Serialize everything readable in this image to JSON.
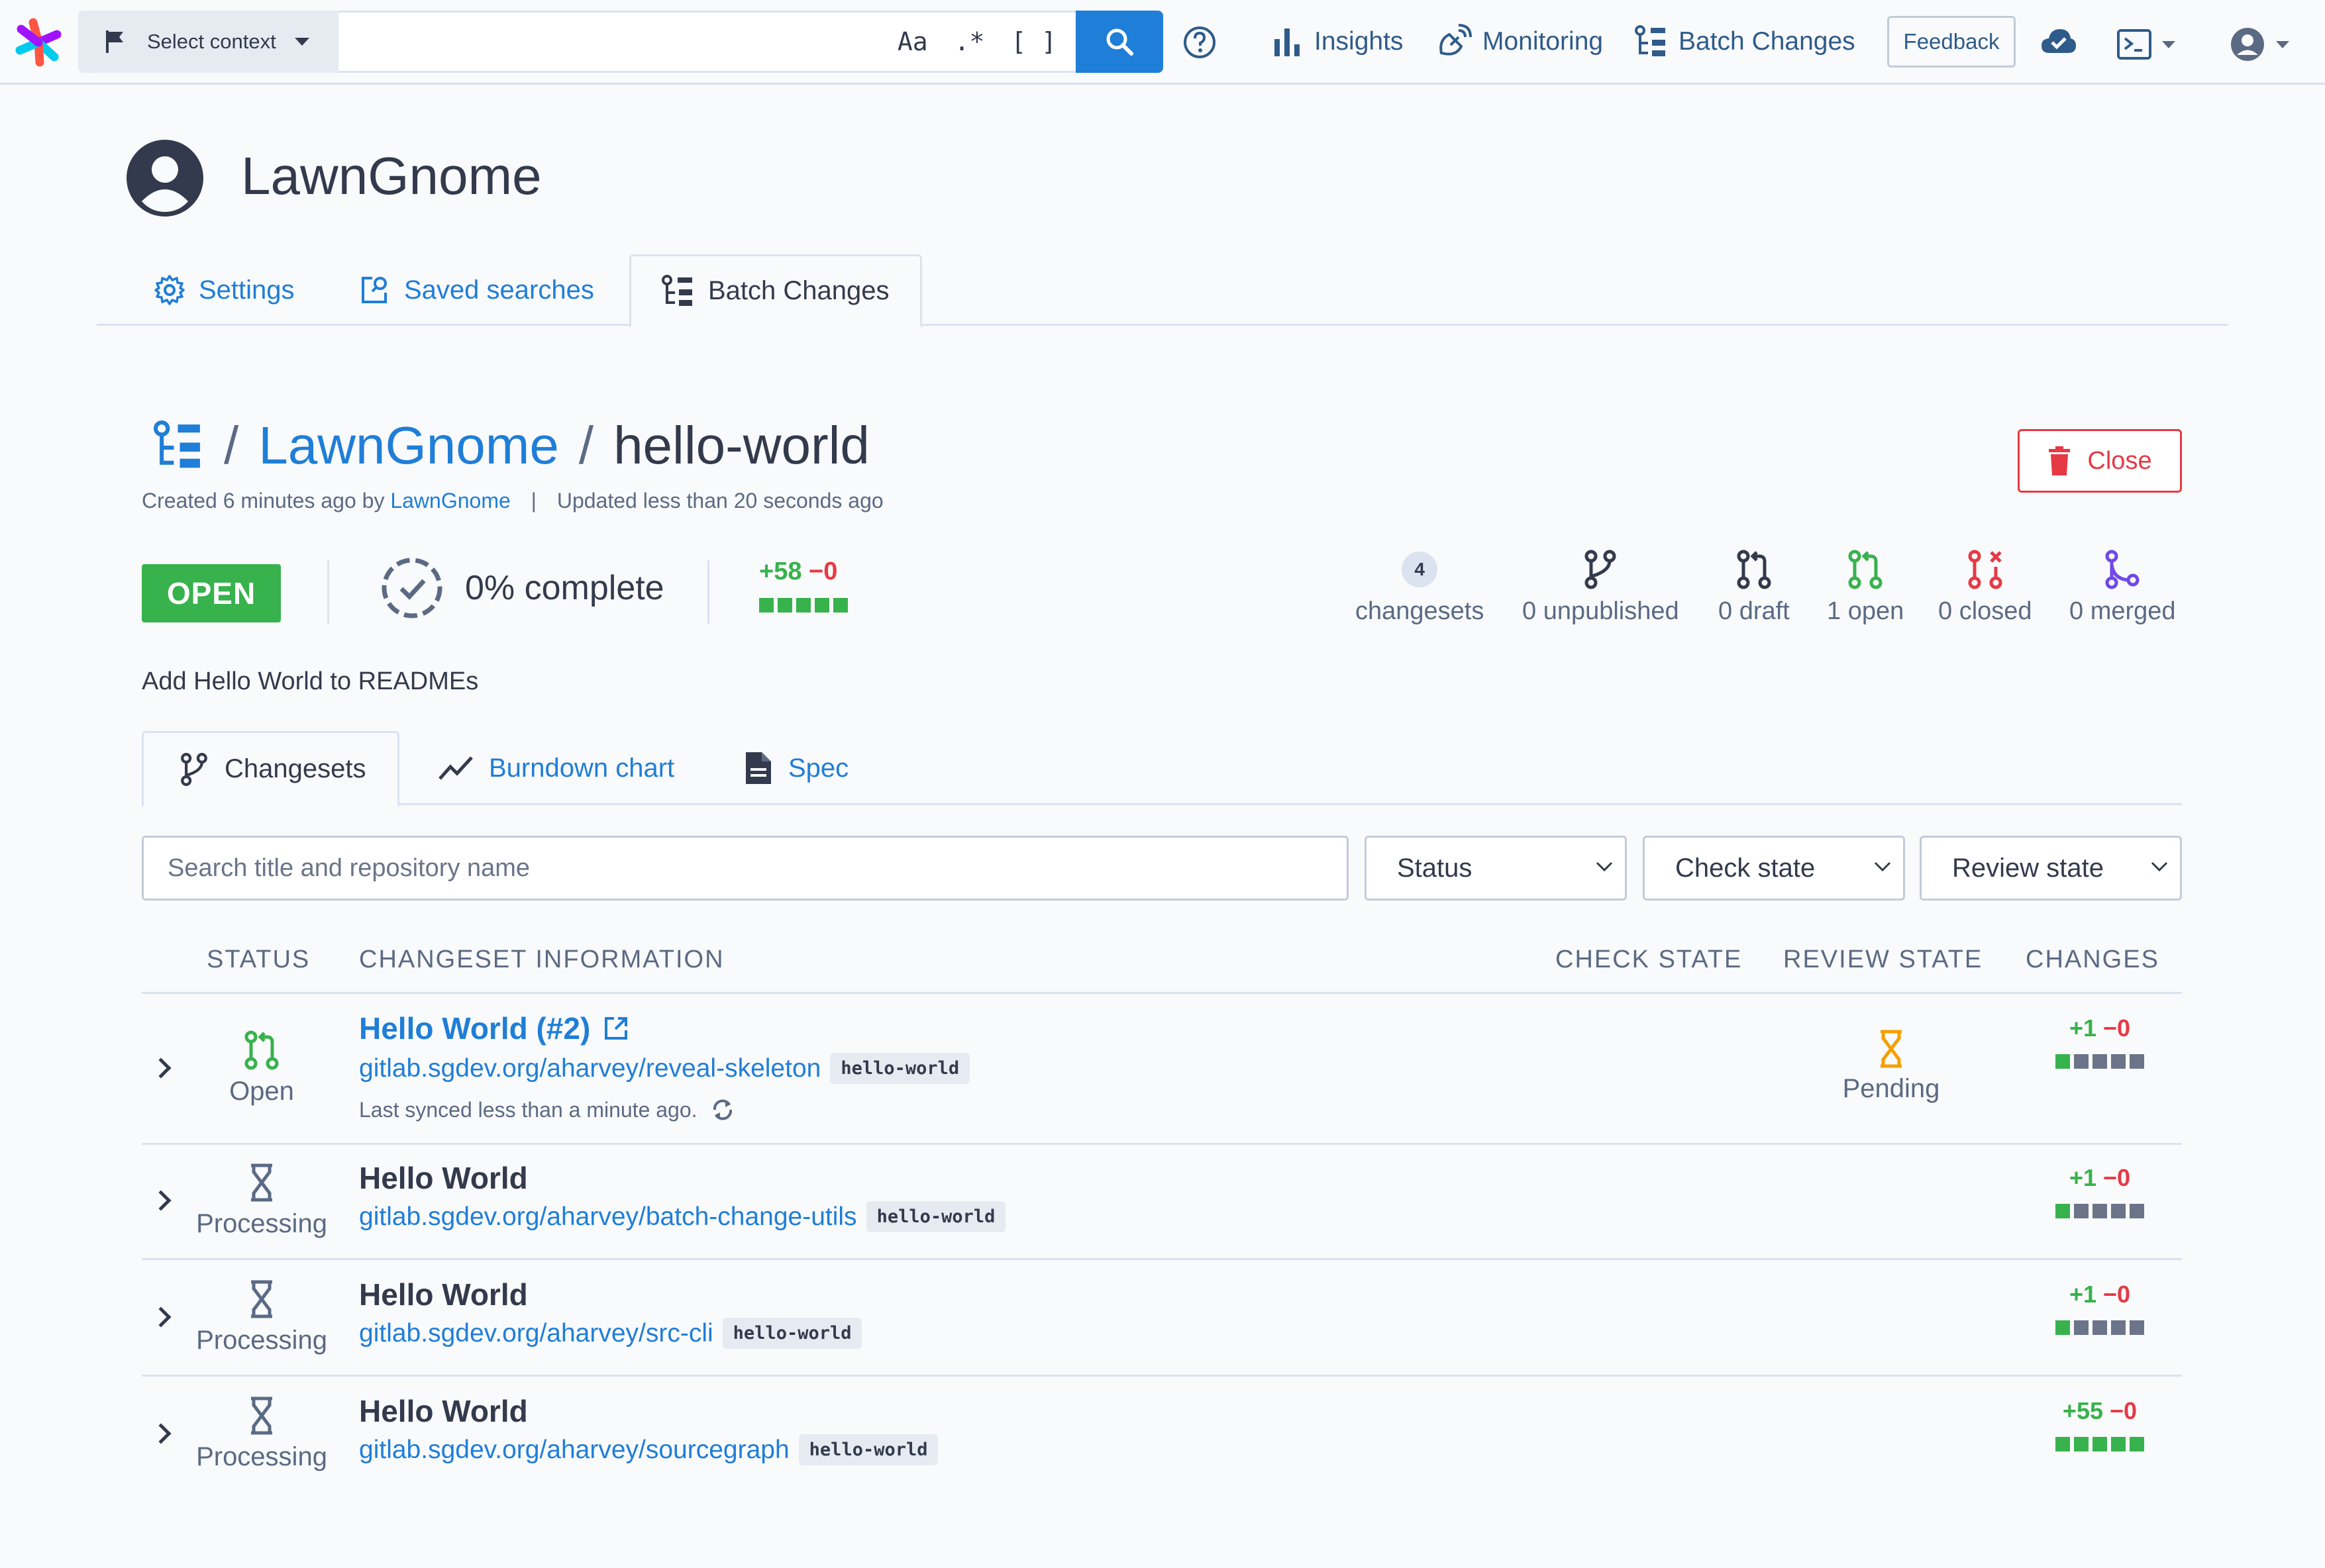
{
  "colors": {
    "accent": "#1f7ed8",
    "open_green": "#37b24d",
    "danger_red": "#e63946",
    "merged_purple": "#7048e8",
    "pending_orange": "#f59f00",
    "neutral_gray": "#6b7489"
  },
  "navbar": {
    "context_label": "Select context",
    "search_value": "",
    "toggle_case": "Aa",
    "toggle_regex": ".*",
    "toggle_structural": "[ ]",
    "insights": "Insights",
    "monitoring": "Monitoring",
    "batch_changes": "Batch Changes",
    "feedback": "Feedback"
  },
  "user": {
    "name": "LawnGnome",
    "tabs": [
      {
        "label": "Settings",
        "icon": "gear-icon"
      },
      {
        "label": "Saved searches",
        "icon": "saved-search-icon"
      },
      {
        "label": "Batch Changes",
        "icon": "batch-changes-icon",
        "active": true
      }
    ]
  },
  "batch_change": {
    "namespace": "LawnGnome",
    "name": "hello-world",
    "created_prefix": "Created 6 minutes ago by",
    "author": "LawnGnome",
    "updated": "Updated less than 20 seconds ago",
    "close_label": "Close",
    "state": "OPEN",
    "progress_label": "0% complete",
    "progress_percent": 0,
    "diff_added": "+58",
    "diff_deleted": "−0",
    "description": "Add Hello World to READMEs",
    "stats": {
      "changesets_count": "4",
      "changesets_label": "changesets",
      "unpublished": "0 unpublished",
      "draft": "0 draft",
      "open": "1 open",
      "closed": "0 closed",
      "merged": "0 merged"
    }
  },
  "inner_tabs": [
    {
      "label": "Changesets",
      "icon": "changeset-branch-icon",
      "active": true
    },
    {
      "label": "Burndown chart",
      "icon": "chart-line-icon"
    },
    {
      "label": "Spec",
      "icon": "file-document-icon"
    }
  ],
  "filters": {
    "search_placeholder": "Search title and repository name",
    "status": "Status",
    "check_state": "Check state",
    "review_state": "Review state"
  },
  "table": {
    "headers": {
      "status": "STATUS",
      "info": "CHANGESET INFORMATION",
      "check": "CHECK STATE",
      "review": "REVIEW STATE",
      "changes": "CHANGES"
    },
    "rows": [
      {
        "status": "Open",
        "title": "Hello World (#2)",
        "repo": "gitlab.sgdev.org/aharvey/reveal-skeleton",
        "branch": "hello-world",
        "synced": "Last synced less than a minute ago.",
        "review": "Pending",
        "added": "+1",
        "deleted": "−0"
      },
      {
        "status": "Processing",
        "title": "Hello World",
        "repo": "gitlab.sgdev.org/aharvey/batch-change-utils",
        "branch": "hello-world",
        "added": "+1",
        "deleted": "−0"
      },
      {
        "status": "Processing",
        "title": "Hello World",
        "repo": "gitlab.sgdev.org/aharvey/src-cli",
        "branch": "hello-world",
        "added": "+1",
        "deleted": "−0"
      },
      {
        "status": "Processing",
        "title": "Hello World",
        "repo": "gitlab.sgdev.org/aharvey/sourcegraph",
        "branch": "hello-world",
        "added": "+55",
        "deleted": "−0"
      }
    ]
  }
}
